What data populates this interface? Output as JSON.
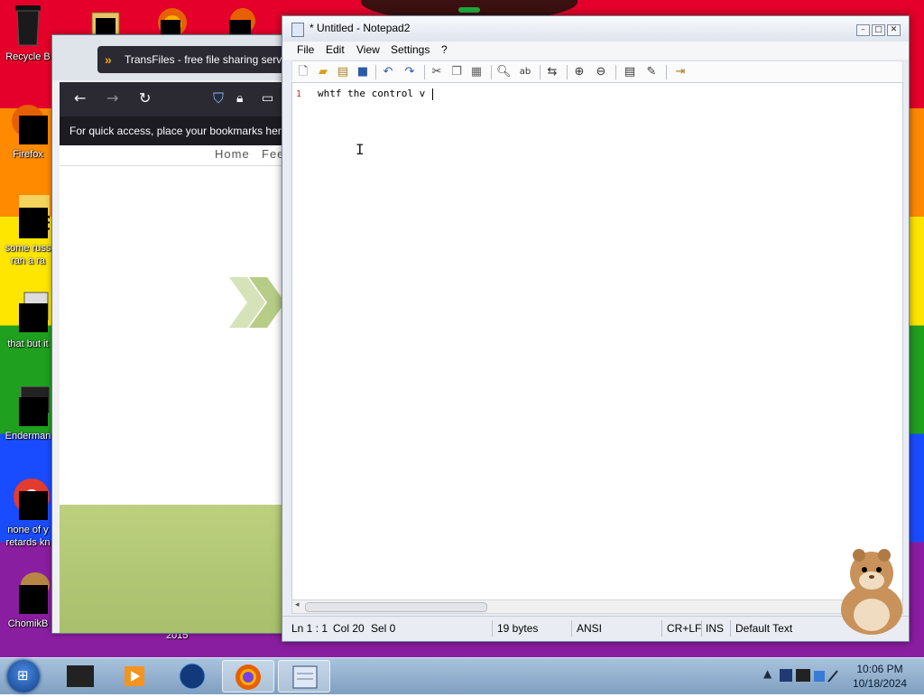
{
  "desktop": {
    "icons": [
      {
        "label": "Recycle B",
        "icon": "recycle-bin-icon"
      },
      {
        "label": "Firefox",
        "icon": "firefox-icon"
      },
      {
        "label": "some russ",
        "label2": "ran a ra",
        "icon": "document-icon"
      },
      {
        "label": "that but it",
        "icon": "folder-icon"
      },
      {
        "label": "Enderman",
        "icon": "app-icon"
      },
      {
        "label": "none of y",
        "label2": "retards kn",
        "icon": "chrome-icon"
      },
      {
        "label": "ChomikB",
        "icon": "hamster-icon"
      }
    ],
    "corner_text": "2015"
  },
  "browser": {
    "tab_title": "TransFiles - free file sharing serv",
    "bookmarks_hint": "For quick access, place your bookmarks here",
    "site_nav": [
      "Home",
      "Fee"
    ]
  },
  "notepad": {
    "title": "* Untitled - Notepad2",
    "menu": [
      "File",
      "Edit",
      "View",
      "Settings",
      "?"
    ],
    "line_number": "1",
    "line_text": "whtf the control v ",
    "status": {
      "position": "Ln 1 : 1",
      "col": "Col 20",
      "sel": "Sel 0",
      "size": "19 bytes",
      "encoding": "ANSI",
      "eol": "CR+LF",
      "mode": "INS",
      "scheme": "Default Text"
    }
  },
  "taskbar": {
    "clock_time": "10:06 PM",
    "clock_date": "10/18/2024"
  }
}
